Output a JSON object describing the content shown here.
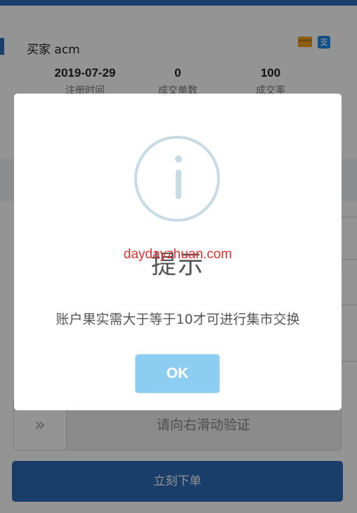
{
  "buyer": {
    "label": "买家 acm"
  },
  "payment": {
    "card_icon": "bank-card-icon",
    "alipay_icon": "alipay-icon",
    "alipay_glyph": "支"
  },
  "stats": [
    {
      "value": "2019-07-29",
      "label": "注册时间"
    },
    {
      "value": "0",
      "label": "成交单数"
    },
    {
      "value": "100",
      "label": "成交率"
    }
  ],
  "slider": {
    "handle": "»",
    "text": "请向右滑动验证"
  },
  "order": {
    "label": "立刻下单"
  },
  "dialog": {
    "icon": "info-icon",
    "title": "提示",
    "watermark": "daydayzhuan.com",
    "message": "账户果实需大于等于10才可进行集市交换",
    "ok_label": "OK"
  },
  "colors": {
    "primary": "#2a6bb5",
    "ok_button": "#8ccdf1",
    "watermark": "#e23030"
  }
}
